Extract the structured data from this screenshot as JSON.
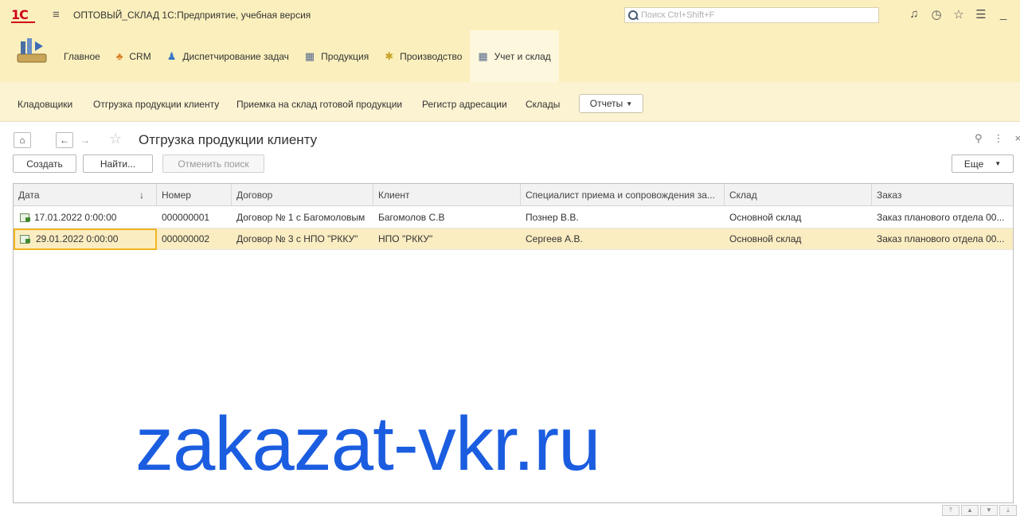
{
  "titlebar": {
    "logo": "1С",
    "title": "ОПТОВЫЙ_СКЛАД 1С:Предприятие, учебная версия",
    "search_placeholder": "Поиск Ctrl+Shift+F"
  },
  "sections": [
    {
      "label": "Главное"
    },
    {
      "label": "CRM"
    },
    {
      "label": "Диспетчирование задач"
    },
    {
      "label": "Продукция"
    },
    {
      "label": "Производство"
    },
    {
      "label": "Учет и склад"
    }
  ],
  "subsections": [
    {
      "label": "Кладовщики"
    },
    {
      "label": "Отгрузка продукции клиенту"
    },
    {
      "label": "Приемка на склад готовой продукции"
    },
    {
      "label": "Регистр адресации"
    },
    {
      "label": "Склады"
    }
  ],
  "reports_label": "Отчеты",
  "form": {
    "title": "Отгрузка продукции клиенту"
  },
  "toolbar": {
    "create": "Создать",
    "find": "Найти...",
    "cancel_search": "Отменить поиск",
    "more": "Еще"
  },
  "table": {
    "columns": [
      "Дата",
      "Номер",
      "Договор",
      "Клиент",
      "Специалист приема и сопровождения за...",
      "Склад",
      "Заказ"
    ],
    "sort_indicator": "↓",
    "rows": [
      [
        "17.01.2022 0:00:00",
        "000000001",
        "Договор № 1 с Багомоловым",
        "Багомолов С.В",
        "Познер В.В.",
        "Основной склад",
        "Заказ планового отдела 00..."
      ],
      [
        "29.01.2022 0:00:00",
        "000000002",
        "Договор № 3 с НПО \"РККУ\"",
        "НПО \"РККУ\"",
        "Сергеев А.В.",
        "Основной склад",
        "Заказ планового отдела 00..."
      ]
    ]
  },
  "watermark": "zakazat-vkr.ru",
  "colors": {
    "panel": "#fbf0bd",
    "selection": "#fbedc2",
    "watermark": "#1b5de0"
  }
}
